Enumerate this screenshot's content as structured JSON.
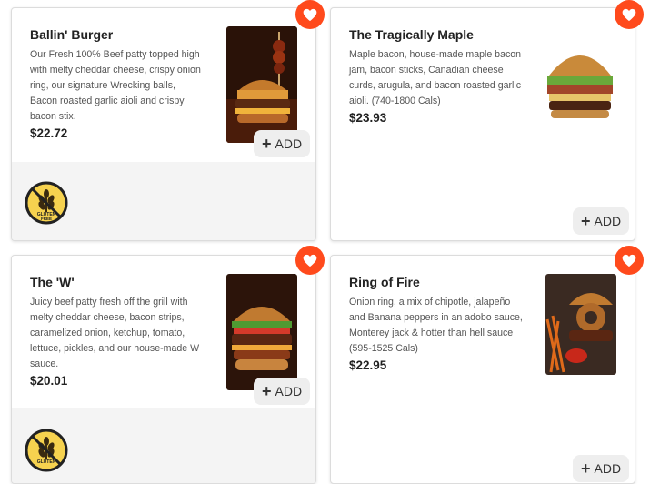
{
  "items": [
    {
      "title": "Ballin' Burger",
      "description": "Our Fresh 100% Beef patty topped high with melty cheddar cheese, crispy onion ring, our signature Wrecking balls, Bacon roasted garlic aioli and crispy bacon stix.",
      "price": "$22.72",
      "add_label": "ADD",
      "badge_text": [
        "GLUTEN",
        "FREE"
      ]
    },
    {
      "title": "The Tragically Maple",
      "description": "Maple bacon, house-made maple bacon jam, bacon sticks, Canadian cheese curds, arugula, and bacon roasted garlic aioli. (740-1800 Cals)",
      "price": "$23.93",
      "add_label": "ADD"
    },
    {
      "title": "The 'W'",
      "description": "Juicy beef patty fresh off the grill with melty cheddar cheese, bacon strips, caramelized onion, ketchup, tomato, lettuce, pickles, and our house-made W sauce.",
      "price": "$20.01",
      "add_label": "ADD",
      "badge_text": [
        "GLUTEN"
      ]
    },
    {
      "title": "Ring of Fire",
      "description": "Onion ring, a mix of chipotle, jalapeño and Banana peppers in an adobo sauce, Monterey jack & hotter than hell sauce (595-1525 Cals)",
      "price": "$22.95",
      "add_label": "ADD"
    }
  ],
  "colors": {
    "heart": "#ff4a1c",
    "badge": "#f6d24f"
  }
}
